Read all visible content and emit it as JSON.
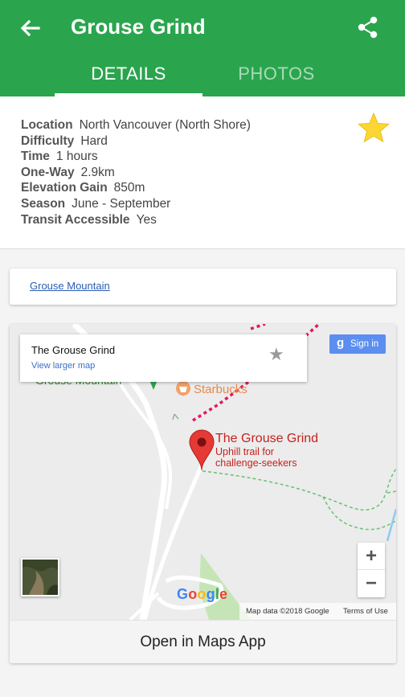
{
  "app_bar": {
    "title": "Grouse Grind",
    "back_icon": "arrow-back-icon",
    "share_icon": "share-icon",
    "color": "#2aa54e"
  },
  "tabs": [
    {
      "label": "DETAILS",
      "active": true
    },
    {
      "label": "PHOTOS",
      "active": false
    }
  ],
  "details": [
    {
      "key": "Location",
      "value": "North Vancouver (North Shore)"
    },
    {
      "key": "Difficulty",
      "value": "Hard"
    },
    {
      "key": "Time",
      "value": "1 hours"
    },
    {
      "key": "One-Way",
      "value": "2.9km"
    },
    {
      "key": "Elevation Gain",
      "value": "850m"
    },
    {
      "key": "Season",
      "value": "June - September"
    },
    {
      "key": "Transit Accessible",
      "value": "Yes"
    }
  ],
  "favorite": {
    "icon": "star-icon",
    "color": "#fcd733",
    "selected": true
  },
  "link": {
    "text": "Grouse Mountain"
  },
  "map": {
    "infobox": {
      "name": "The Grouse Grind",
      "larger_map": "View larger map",
      "save_icon": "star-outline-icon"
    },
    "sign_in": {
      "g": "g",
      "label": "Sign in"
    },
    "pin_label_title": "The Grouse Grind",
    "pin_label_line1": "Uphill trail for",
    "pin_label_line2": "challenge-seekers",
    "starbucks": "Starbucks",
    "grouse_mountain": "Grouse Mountain",
    "zoom_in": "+",
    "zoom_out": "−",
    "google_letters": [
      "G",
      "o",
      "o",
      "g",
      "l",
      "e"
    ],
    "google_colors": [
      "#4285f4",
      "#ea4335",
      "#fbbc05",
      "#4285f4",
      "#34a853",
      "#ea4335"
    ],
    "map_data": "Map data ©2018 Google",
    "terms": "Terms of Use"
  },
  "open_maps": "Open in Maps App"
}
